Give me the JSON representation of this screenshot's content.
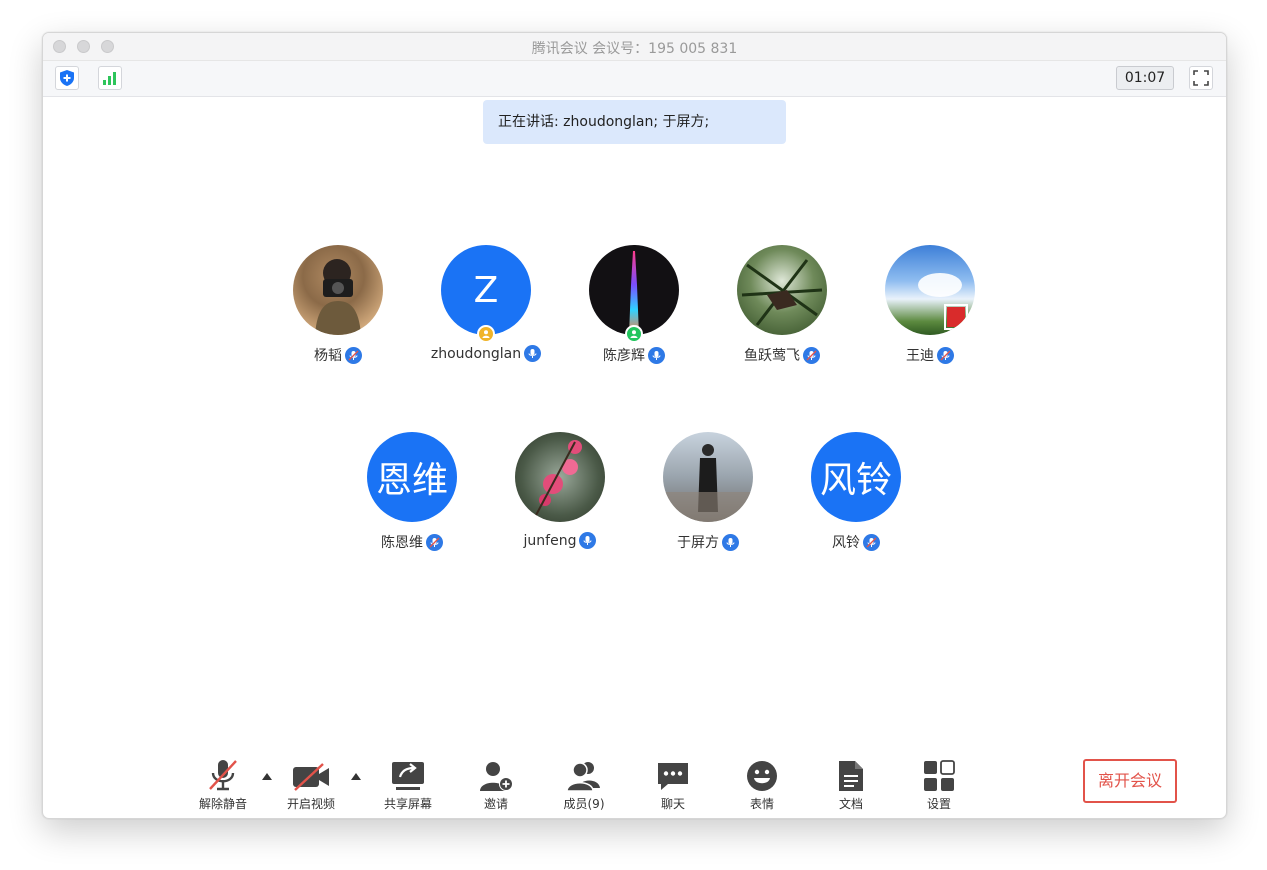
{
  "window": {
    "title": "腾讯会议 会议号：195 005 831"
  },
  "topbar": {
    "timer": "01:07"
  },
  "speaking": {
    "text": "正在讲话: zhoudonglan; 于屏方;"
  },
  "participants": [
    {
      "name": "杨韬",
      "avatar_type": "photo",
      "muted": true
    },
    {
      "name": "zhoudonglan",
      "avatar_type": "initial",
      "initial": "Z",
      "avatar_color": "#1a73f5",
      "role_badge": "host",
      "role_color": "#f0b429",
      "muted": false
    },
    {
      "name": "陈彦辉",
      "avatar_type": "photo",
      "role_badge": "cohost",
      "role_color": "#22c55e",
      "muted": false
    },
    {
      "name": "鱼跃莺飞",
      "avatar_type": "photo",
      "muted": true
    },
    {
      "name": "王迪",
      "avatar_type": "photo",
      "muted": true
    },
    {
      "name": "陈恩维",
      "avatar_type": "initial",
      "initial": "恩维",
      "avatar_color": "#1a73f5",
      "muted": true
    },
    {
      "name": "junfeng",
      "avatar_type": "photo",
      "muted": false
    },
    {
      "name": "于屏方",
      "avatar_type": "photo",
      "muted": false
    },
    {
      "name": "风铃",
      "avatar_type": "initial",
      "initial": "风铃",
      "avatar_color": "#1a73f5",
      "muted": true
    }
  ],
  "toolbar": {
    "unmute": "解除静音",
    "start_video": "开启视频",
    "share_screen": "共享屏幕",
    "invite": "邀请",
    "members": "成员(9)",
    "chat": "聊天",
    "reactions": "表情",
    "documents": "文档",
    "settings": "设置",
    "leave": "离开会议"
  },
  "colors": {
    "accent": "#1a73f5",
    "leave": "#e2534a",
    "banner": "#dbe8fc",
    "signal": "#2ec55b"
  }
}
